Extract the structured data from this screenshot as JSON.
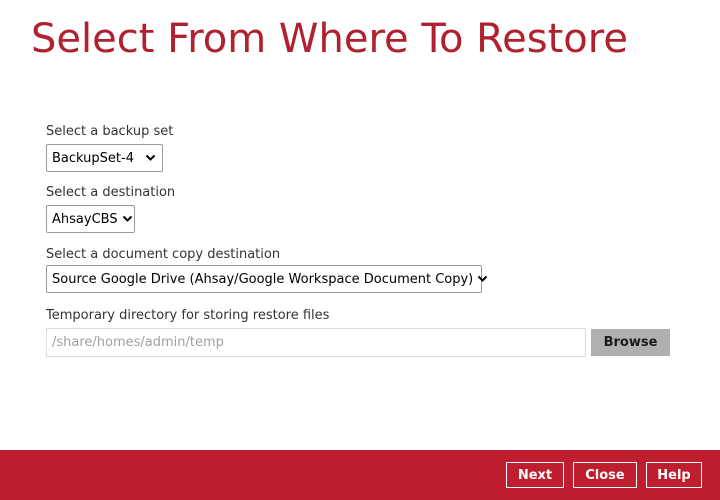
{
  "title": "Select From Where To Restore",
  "backup_set": {
    "label": "Select a backup set",
    "selected": "BackupSet-4"
  },
  "destination": {
    "label": "Select a destination",
    "selected": "AhsayCBS"
  },
  "copy_destination": {
    "label": "Select a document copy destination",
    "selected": "Source Google Drive (Ahsay/Google Workspace Document Copy)"
  },
  "temp_dir": {
    "label": "Temporary directory for storing restore files",
    "placeholder": "/share/homes/admin/temp",
    "browse_label": "Browse"
  },
  "footer": {
    "next_label": "Next",
    "close_label": "Close",
    "help_label": "Help"
  },
  "colors": {
    "brand_red": "#be1e2d",
    "title_red": "#b0202e"
  },
  "icons": {
    "dropdown": "chevron-down-icon"
  }
}
